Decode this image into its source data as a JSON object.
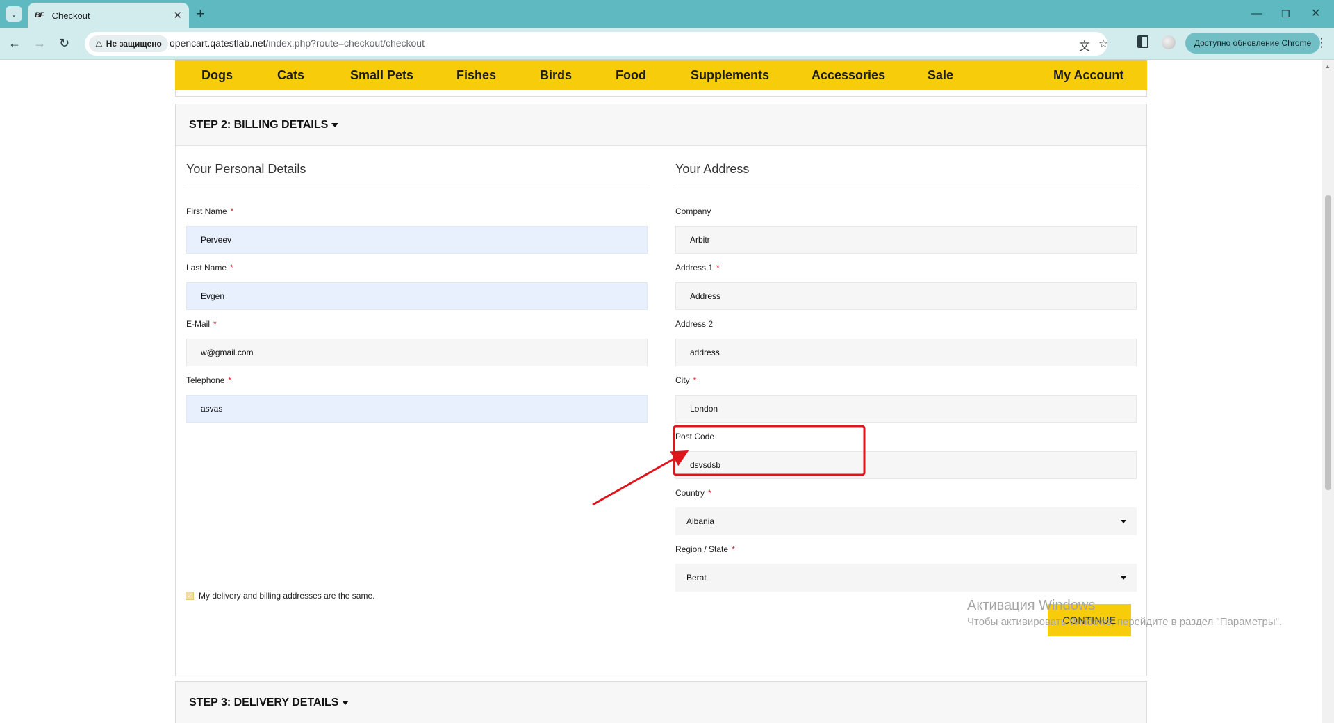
{
  "browser": {
    "tab_title": "Checkout",
    "tab_favicon": "BF",
    "security_label": "Не защищено",
    "url_host": "opencart.qatestlab.net",
    "url_path": "/index.php?route=checkout/checkout",
    "update_label": "Доступно обновление Chrome"
  },
  "menu": {
    "items": [
      "Dogs",
      "Cats",
      "Small Pets",
      "Fishes",
      "Birds",
      "Food",
      "Supplements",
      "Accessories",
      "Sale"
    ],
    "account": "My Account"
  },
  "step2": {
    "title": "STEP 2: BILLING DETAILS",
    "personal": {
      "legend": "Your Personal Details",
      "first_name": {
        "label": "First Name",
        "value": "Perveev"
      },
      "last_name": {
        "label": "Last Name",
        "value": "Evgen"
      },
      "email": {
        "label": "E-Mail",
        "value": "w@gmail.com"
      },
      "telephone": {
        "label": "Telephone",
        "value": "asvas"
      }
    },
    "address": {
      "legend": "Your Address",
      "company": {
        "label": "Company",
        "value": "Arbitr"
      },
      "address1": {
        "label": "Address 1",
        "value": "Address"
      },
      "address2": {
        "label": "Address 2",
        "value": "address"
      },
      "city": {
        "label": "City",
        "value": "London"
      },
      "postcode": {
        "label": "Post Code",
        "value": "dsvsdsb"
      },
      "country": {
        "label": "Country",
        "value": "Albania"
      },
      "region": {
        "label": "Region / State",
        "value": "Berat"
      }
    },
    "same_address_label": "My delivery and billing addresses are the same.",
    "continue_label": "CONTINUE"
  },
  "step3": {
    "title": "STEP 3: DELIVERY DETAILS"
  },
  "watermark": {
    "title": "Активация Windows",
    "subtitle": "Чтобы активировать Windows, перейдите в раздел \"Параметры\"."
  },
  "colors": {
    "accent_yellow": "#f7cc0b",
    "chrome_teal": "#5fb9c0",
    "annotation_red": "#e0141b",
    "autofill_blue": "#e8f0fe"
  }
}
